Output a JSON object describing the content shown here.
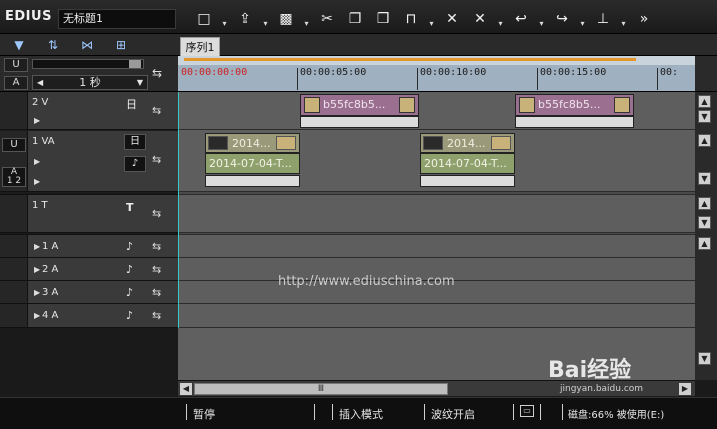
{
  "app": {
    "title": "EDIUS",
    "project_name": "无标题1"
  },
  "toolbar": {
    "buttons": [
      {
        "name": "new",
        "glyph": "🗋"
      },
      {
        "name": "open",
        "glyph": "⤒"
      },
      {
        "name": "save",
        "glyph": "💾"
      },
      {
        "name": "cut",
        "glyph": "✂"
      },
      {
        "name": "copy",
        "glyph": "❐"
      },
      {
        "name": "paste",
        "glyph": "📋"
      },
      {
        "name": "replace",
        "glyph": "⧉"
      },
      {
        "name": "delete",
        "glyph": "✕"
      },
      {
        "name": "ripple-delete",
        "glyph": "✕"
      },
      {
        "name": "undo",
        "glyph": "↩"
      },
      {
        "name": "redo",
        "glyph": "↪"
      },
      {
        "name": "marker",
        "glyph": "⊥"
      },
      {
        "name": "more",
        "glyph": "»"
      }
    ]
  },
  "sequence_tab": "序列1",
  "scale": {
    "unit": "1 秒",
    "lock_v": "U",
    "lock_a": "A"
  },
  "ruler": {
    "timecodes": [
      "00:00:00:00",
      "00:00:05:00",
      "00:00:10:00",
      "00:00:15:00",
      "00:"
    ]
  },
  "tracks": {
    "v2": {
      "name": "2 V",
      "part_icon": "日"
    },
    "va1": {
      "name": "1 VA",
      "part_icon": "日",
      "audio_icon": "🔊",
      "lock_v": "U",
      "lock_a": "A",
      "channels": "1 2"
    },
    "t1": {
      "name": "1 T",
      "part_icon": "T"
    },
    "a1": {
      "name": "1 A"
    },
    "a2": {
      "name": "2 A"
    },
    "a3": {
      "name": "3 A"
    },
    "a4": {
      "name": "4 A"
    }
  },
  "clips": {
    "v2_clip_label": "b55fc8b5...",
    "va_video_label": "2014...",
    "va_audio_label": "2014-07-04-T..."
  },
  "watermark": "http://www.ediuschina.com",
  "status": {
    "pause": "暂停",
    "insert_mode": "插入模式",
    "ripple": "波纹开启",
    "disk": "磁盘:66% 被使用(E:)"
  },
  "overlay": {
    "brand": "Bai经验",
    "sub": "jingyan.baidu.com"
  },
  "colors": {
    "accent_clip_video": "#9a6f90",
    "accent_clip_va": "#9a9a7a",
    "cursor": "#38c6c6",
    "ruler_orange": "#e3972d"
  }
}
